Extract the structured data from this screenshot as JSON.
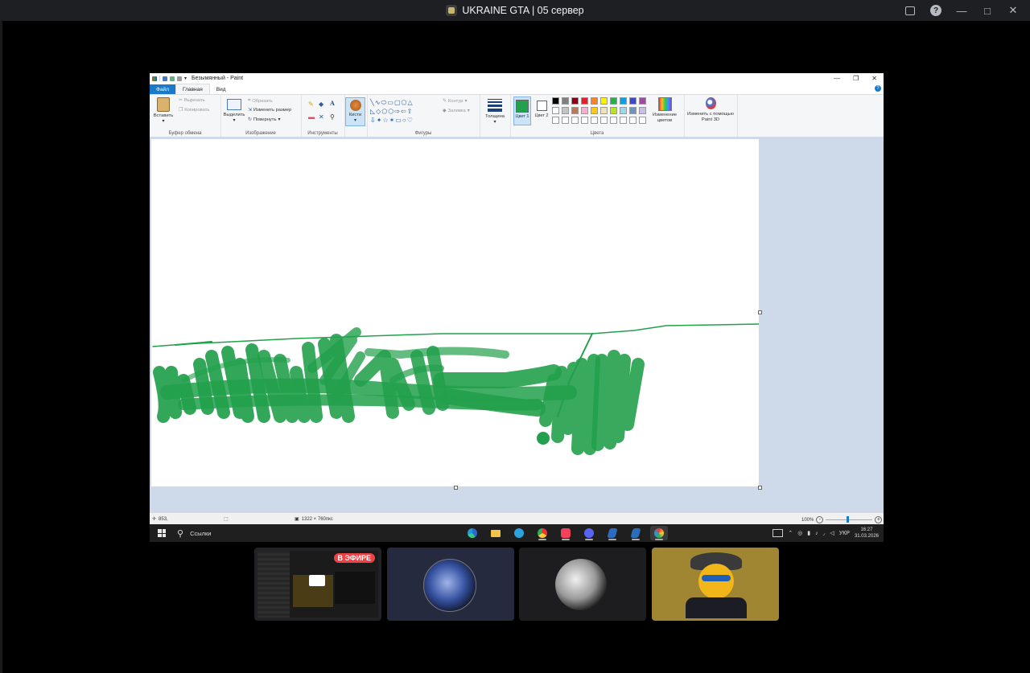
{
  "discord": {
    "title": "UKRAINE GTA | 05 сервер",
    "help_glyph": "?"
  },
  "paint": {
    "window_title": "Безымянный - Paint",
    "tabs": {
      "file": "Файл",
      "home": "Главная",
      "view": "Вид"
    },
    "clipboard": {
      "paste": "Вставить",
      "cut": "Вырезать",
      "copy": "Копировать",
      "label": "Буфер обмена"
    },
    "image": {
      "select": "Выделить",
      "crop": "Обрезать",
      "resize": "Изменить размер",
      "rotate": "Повернуть",
      "label": "Изображение"
    },
    "tools": {
      "label": "Инструменты",
      "text_glyph": "A"
    },
    "brushes": {
      "label": "Кисти"
    },
    "shapes": {
      "outline": "Контур",
      "fill": "Заливка",
      "label": "Фигуры"
    },
    "size": {
      "label": "Толщина"
    },
    "colors": {
      "color1": "Цвет 1",
      "color2": "Цвет 2",
      "edit": "Изменение цветов",
      "label": "Цвета",
      "color1_value": "#22a04b",
      "color2_value": "#ffffff",
      "palette_row1": [
        "#000000",
        "#7f7f7f",
        "#880015",
        "#ed1c24",
        "#ff7f27",
        "#fff200",
        "#22b14c",
        "#00a2e8",
        "#3f48cc",
        "#a349a4"
      ],
      "palette_row2": [
        "#ffffff",
        "#c3c3c3",
        "#b97a57",
        "#ffaec9",
        "#ffc90e",
        "#efe4b0",
        "#b5e61d",
        "#99d9ea",
        "#7092be",
        "#c8bfe7"
      ]
    },
    "paint3d": {
      "label": "Изменить с помощью Paint 3D"
    },
    "status": {
      "cursor": "853,",
      "image_size": "1322 × 760пкс",
      "zoom": "100%"
    },
    "brush_color": "#22a04b"
  },
  "taskbar": {
    "search": "Ссылки",
    "lang": "УКР",
    "time": "16:27",
    "date": "31.03.2026"
  },
  "streams": {
    "live_badge": "В ЭФИРЕ"
  }
}
